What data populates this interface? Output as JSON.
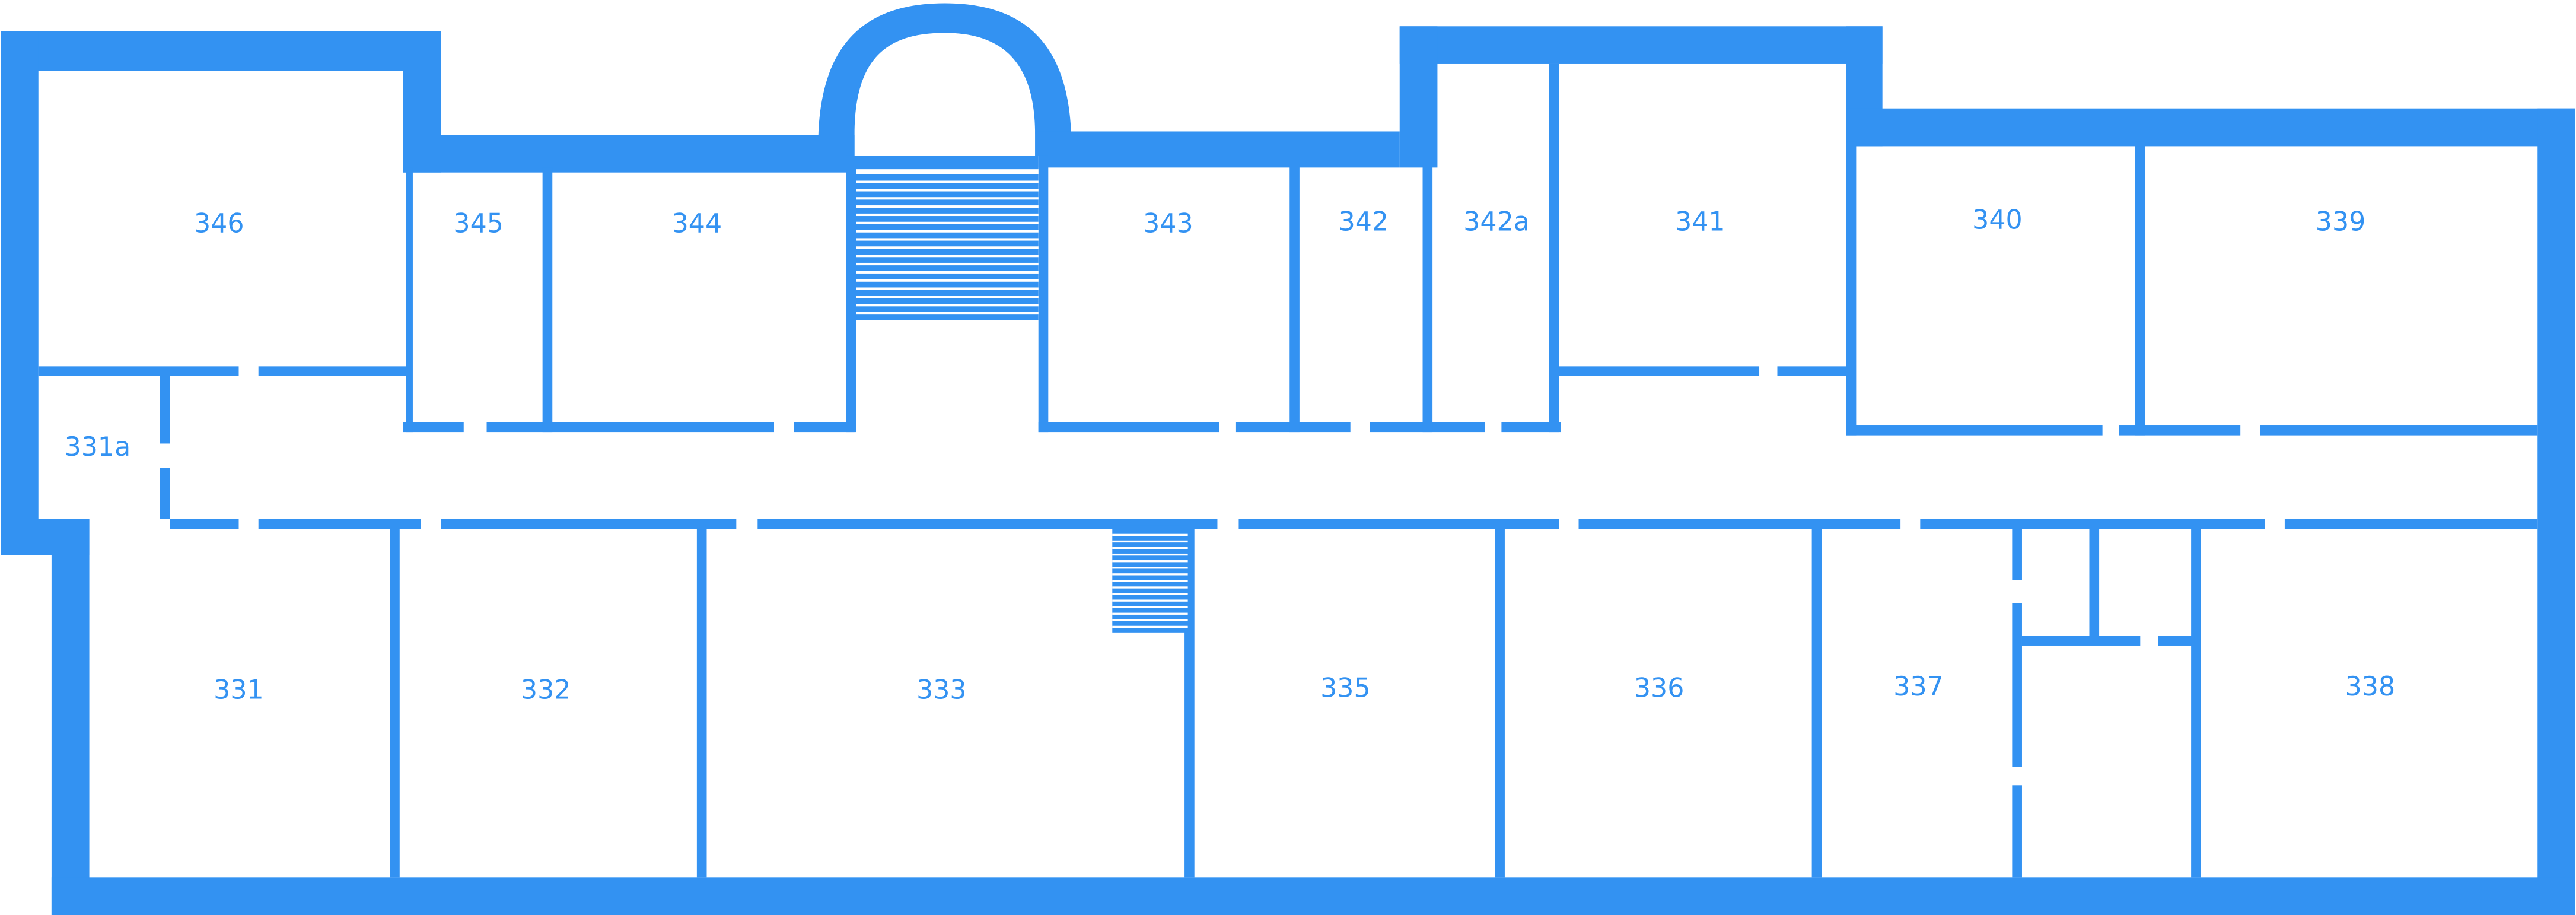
{
  "floor_plan": {
    "wall_color": "#3392F2",
    "background_color": "#FFFFFF",
    "rooms": [
      {
        "id": "346",
        "label": "346"
      },
      {
        "id": "345",
        "label": "345"
      },
      {
        "id": "344",
        "label": "344"
      },
      {
        "id": "343",
        "label": "343"
      },
      {
        "id": "342",
        "label": "342"
      },
      {
        "id": "342a",
        "label": "342a"
      },
      {
        "id": "341",
        "label": "341"
      },
      {
        "id": "340",
        "label": "340"
      },
      {
        "id": "339",
        "label": "339"
      },
      {
        "id": "331a",
        "label": "331a"
      },
      {
        "id": "331",
        "label": "331"
      },
      {
        "id": "332",
        "label": "332"
      },
      {
        "id": "333",
        "label": "333"
      },
      {
        "id": "335",
        "label": "335"
      },
      {
        "id": "336",
        "label": "336"
      },
      {
        "id": "337",
        "label": "337"
      },
      {
        "id": "338",
        "label": "338"
      }
    ]
  }
}
